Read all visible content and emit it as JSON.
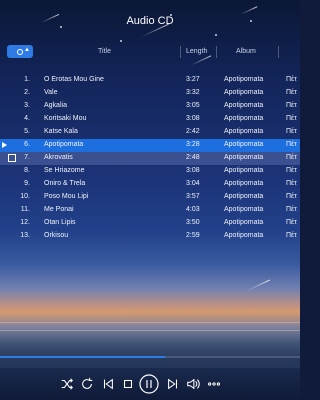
{
  "window": {
    "title": "Audio CD"
  },
  "header": {
    "hash": "#",
    "sort_arrow": "▲",
    "col_title": "Title",
    "col_length": "Length",
    "col_album": "Album"
  },
  "tracks": [
    {
      "num": "1.",
      "title": "O Erotas Mou Gine",
      "length": "3:27",
      "album": "Apotipomata",
      "artist": "Πέτ"
    },
    {
      "num": "2.",
      "title": "Vale",
      "length": "3:32",
      "album": "Apotipomata",
      "artist": "Πέτ"
    },
    {
      "num": "3.",
      "title": "Agkalia",
      "length": "3:05",
      "album": "Apotipomata",
      "artist": "Πέτ"
    },
    {
      "num": "4.",
      "title": "Koritsaki Mou",
      "length": "3:08",
      "album": "Apotipomata",
      "artist": "Πέτ"
    },
    {
      "num": "5.",
      "title": "Katse Kala",
      "length": "2:42",
      "album": "Apotipomata",
      "artist": "Πέτ"
    },
    {
      "num": "6.",
      "title": "Apotipomata",
      "length": "3:28",
      "album": "Apotipomata",
      "artist": "Πέτ"
    },
    {
      "num": "7.",
      "title": "Akrovatis",
      "length": "2:48",
      "album": "Apotipomata",
      "artist": "Πέτ"
    },
    {
      "num": "8.",
      "title": "Se Hriazome",
      "length": "3:08",
      "album": "Apotipomata",
      "artist": "Πέτ"
    },
    {
      "num": "9.",
      "title": "Oniro & Trela",
      "length": "3:04",
      "album": "Apotipomata",
      "artist": "Πέτ"
    },
    {
      "num": "10.",
      "title": "Poso Mou Lipi",
      "length": "3:57",
      "album": "Apotipomata",
      "artist": "Πέτ"
    },
    {
      "num": "11.",
      "title": "Me Ponai",
      "length": "4:03",
      "album": "Apotipomata",
      "artist": "Πέτ"
    },
    {
      "num": "12.",
      "title": "Otan Lipis",
      "length": "3:50",
      "album": "Apotipomata",
      "artist": "Πέτ"
    },
    {
      "num": "13.",
      "title": "Orkisou",
      "length": "2:59",
      "album": "Apotipomata",
      "artist": "Πέτ"
    }
  ],
  "state": {
    "playing_index": 5,
    "hover_index": 6,
    "progress_fraction": 0.55
  },
  "controls": [
    "shuffle-icon",
    "repeat-icon",
    "previous-icon",
    "stop-icon",
    "pause-icon",
    "next-icon",
    "volume-icon",
    "more-icon"
  ],
  "colors": {
    "accent": "#2f7be6",
    "selected_row": "#1d6fe0"
  }
}
